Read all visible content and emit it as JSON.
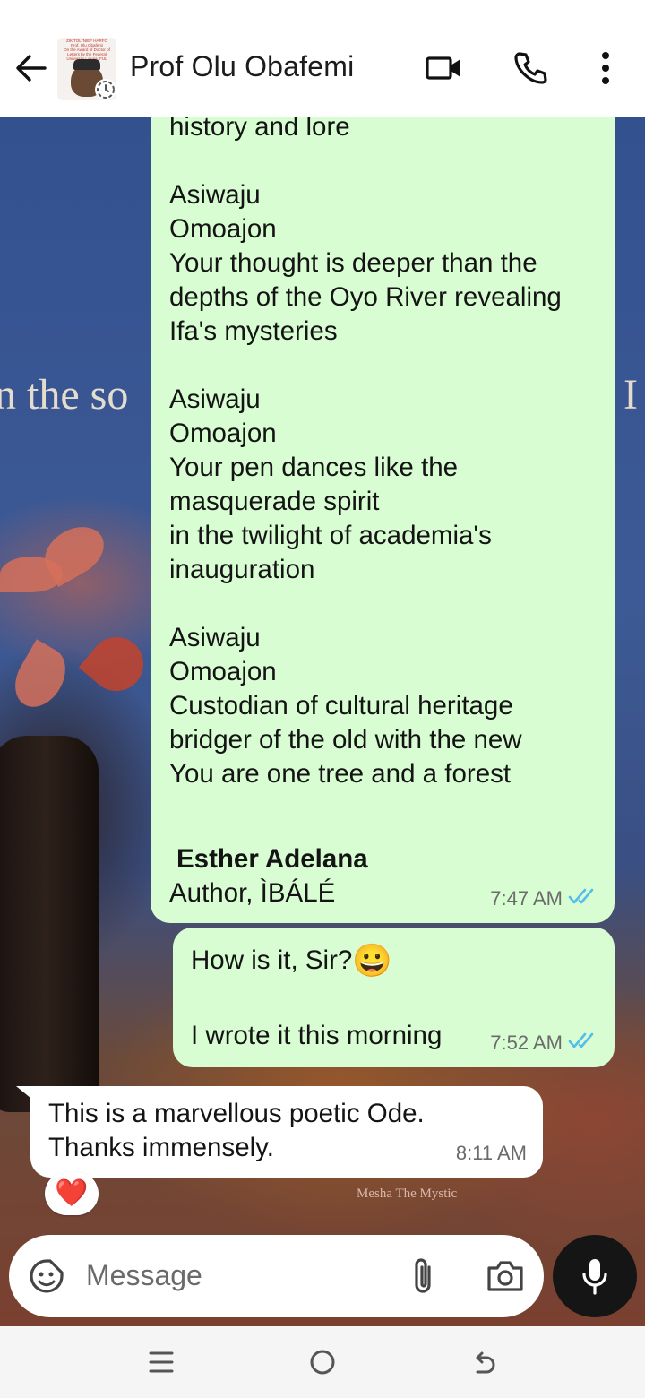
{
  "header": {
    "contact_name": "Prof Olu Obafemi",
    "avatar_caption": "ZIK TOL 'NIEF HARFO\nProf. Olu Obafemi\nOn the Award of Doctor of\nLetters by the Federal\nUniversity Lokoja, FUL",
    "icons": [
      "back-arrow-icon",
      "video-call-icon",
      "phone-call-icon",
      "more-options-icon"
    ]
  },
  "wallpaper": {
    "left_text": "n the so",
    "right_text": "I",
    "signature": "Mesha The Mystic"
  },
  "messages": [
    {
      "direction": "outgoing",
      "text": "through the gentle waves of\nhistory and lore\n\nAsiwaju\nOmoajon\nYour thought is deeper than the\ndepths of the Oyo River revealing\nIfa's mysteries\n\nAsiwaju\nOmoajon\nYour pen dances like the\nmasquerade spirit\nin the twilight of academia's\ninauguration\n\nAsiwaju\nOmoajon\nCustodian of cultural heritage\nbridger of the old with the new\nYou are one tree and a forest",
      "author": "Esther Adelana",
      "author_title": "Author, ÌBÁLÉ",
      "time": "7:47 AM",
      "status": "read"
    },
    {
      "direction": "outgoing",
      "text_line1": "How is it, Sir?",
      "emoji": "😀",
      "text_line2": "I wrote it this morning",
      "time": "7:52 AM",
      "status": "read"
    },
    {
      "direction": "incoming",
      "text": "This is a marvellous poetic Ode.\nThanks immensely.",
      "time": "8:11 AM",
      "reaction": "❤️"
    }
  ],
  "composer": {
    "placeholder": "Message",
    "icons": [
      "sticker-icon",
      "attach-icon",
      "camera-icon",
      "mic-icon"
    ]
  },
  "navbar": {
    "icons": [
      "recent-apps-icon",
      "home-icon",
      "back-icon"
    ]
  },
  "colors": {
    "outgoing_bubble": "#d8fdd2",
    "incoming_bubble": "#ffffff",
    "read_ticks": "#53bdeb",
    "mic_button": "#151515"
  }
}
